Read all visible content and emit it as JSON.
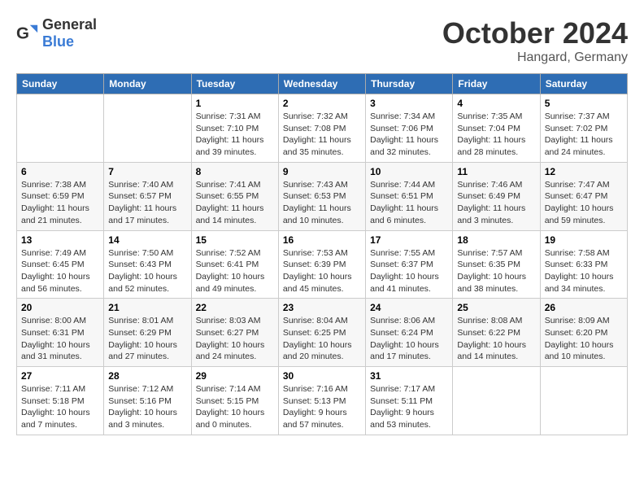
{
  "header": {
    "logo_general": "General",
    "logo_blue": "Blue",
    "month_title": "October 2024",
    "location": "Hangard, Germany"
  },
  "weekdays": [
    "Sunday",
    "Monday",
    "Tuesday",
    "Wednesday",
    "Thursday",
    "Friday",
    "Saturday"
  ],
  "weeks": [
    [
      {
        "day": "",
        "sunrise": "",
        "sunset": "",
        "daylight": ""
      },
      {
        "day": "",
        "sunrise": "",
        "sunset": "",
        "daylight": ""
      },
      {
        "day": "1",
        "sunrise": "Sunrise: 7:31 AM",
        "sunset": "Sunset: 7:10 PM",
        "daylight": "Daylight: 11 hours and 39 minutes."
      },
      {
        "day": "2",
        "sunrise": "Sunrise: 7:32 AM",
        "sunset": "Sunset: 7:08 PM",
        "daylight": "Daylight: 11 hours and 35 minutes."
      },
      {
        "day": "3",
        "sunrise": "Sunrise: 7:34 AM",
        "sunset": "Sunset: 7:06 PM",
        "daylight": "Daylight: 11 hours and 32 minutes."
      },
      {
        "day": "4",
        "sunrise": "Sunrise: 7:35 AM",
        "sunset": "Sunset: 7:04 PM",
        "daylight": "Daylight: 11 hours and 28 minutes."
      },
      {
        "day": "5",
        "sunrise": "Sunrise: 7:37 AM",
        "sunset": "Sunset: 7:02 PM",
        "daylight": "Daylight: 11 hours and 24 minutes."
      }
    ],
    [
      {
        "day": "6",
        "sunrise": "Sunrise: 7:38 AM",
        "sunset": "Sunset: 6:59 PM",
        "daylight": "Daylight: 11 hours and 21 minutes."
      },
      {
        "day": "7",
        "sunrise": "Sunrise: 7:40 AM",
        "sunset": "Sunset: 6:57 PM",
        "daylight": "Daylight: 11 hours and 17 minutes."
      },
      {
        "day": "8",
        "sunrise": "Sunrise: 7:41 AM",
        "sunset": "Sunset: 6:55 PM",
        "daylight": "Daylight: 11 hours and 14 minutes."
      },
      {
        "day": "9",
        "sunrise": "Sunrise: 7:43 AM",
        "sunset": "Sunset: 6:53 PM",
        "daylight": "Daylight: 11 hours and 10 minutes."
      },
      {
        "day": "10",
        "sunrise": "Sunrise: 7:44 AM",
        "sunset": "Sunset: 6:51 PM",
        "daylight": "Daylight: 11 hours and 6 minutes."
      },
      {
        "day": "11",
        "sunrise": "Sunrise: 7:46 AM",
        "sunset": "Sunset: 6:49 PM",
        "daylight": "Daylight: 11 hours and 3 minutes."
      },
      {
        "day": "12",
        "sunrise": "Sunrise: 7:47 AM",
        "sunset": "Sunset: 6:47 PM",
        "daylight": "Daylight: 10 hours and 59 minutes."
      }
    ],
    [
      {
        "day": "13",
        "sunrise": "Sunrise: 7:49 AM",
        "sunset": "Sunset: 6:45 PM",
        "daylight": "Daylight: 10 hours and 56 minutes."
      },
      {
        "day": "14",
        "sunrise": "Sunrise: 7:50 AM",
        "sunset": "Sunset: 6:43 PM",
        "daylight": "Daylight: 10 hours and 52 minutes."
      },
      {
        "day": "15",
        "sunrise": "Sunrise: 7:52 AM",
        "sunset": "Sunset: 6:41 PM",
        "daylight": "Daylight: 10 hours and 49 minutes."
      },
      {
        "day": "16",
        "sunrise": "Sunrise: 7:53 AM",
        "sunset": "Sunset: 6:39 PM",
        "daylight": "Daylight: 10 hours and 45 minutes."
      },
      {
        "day": "17",
        "sunrise": "Sunrise: 7:55 AM",
        "sunset": "Sunset: 6:37 PM",
        "daylight": "Daylight: 10 hours and 41 minutes."
      },
      {
        "day": "18",
        "sunrise": "Sunrise: 7:57 AM",
        "sunset": "Sunset: 6:35 PM",
        "daylight": "Daylight: 10 hours and 38 minutes."
      },
      {
        "day": "19",
        "sunrise": "Sunrise: 7:58 AM",
        "sunset": "Sunset: 6:33 PM",
        "daylight": "Daylight: 10 hours and 34 minutes."
      }
    ],
    [
      {
        "day": "20",
        "sunrise": "Sunrise: 8:00 AM",
        "sunset": "Sunset: 6:31 PM",
        "daylight": "Daylight: 10 hours and 31 minutes."
      },
      {
        "day": "21",
        "sunrise": "Sunrise: 8:01 AM",
        "sunset": "Sunset: 6:29 PM",
        "daylight": "Daylight: 10 hours and 27 minutes."
      },
      {
        "day": "22",
        "sunrise": "Sunrise: 8:03 AM",
        "sunset": "Sunset: 6:27 PM",
        "daylight": "Daylight: 10 hours and 24 minutes."
      },
      {
        "day": "23",
        "sunrise": "Sunrise: 8:04 AM",
        "sunset": "Sunset: 6:25 PM",
        "daylight": "Daylight: 10 hours and 20 minutes."
      },
      {
        "day": "24",
        "sunrise": "Sunrise: 8:06 AM",
        "sunset": "Sunset: 6:24 PM",
        "daylight": "Daylight: 10 hours and 17 minutes."
      },
      {
        "day": "25",
        "sunrise": "Sunrise: 8:08 AM",
        "sunset": "Sunset: 6:22 PM",
        "daylight": "Daylight: 10 hours and 14 minutes."
      },
      {
        "day": "26",
        "sunrise": "Sunrise: 8:09 AM",
        "sunset": "Sunset: 6:20 PM",
        "daylight": "Daylight: 10 hours and 10 minutes."
      }
    ],
    [
      {
        "day": "27",
        "sunrise": "Sunrise: 7:11 AM",
        "sunset": "Sunset: 5:18 PM",
        "daylight": "Daylight: 10 hours and 7 minutes."
      },
      {
        "day": "28",
        "sunrise": "Sunrise: 7:12 AM",
        "sunset": "Sunset: 5:16 PM",
        "daylight": "Daylight: 10 hours and 3 minutes."
      },
      {
        "day": "29",
        "sunrise": "Sunrise: 7:14 AM",
        "sunset": "Sunset: 5:15 PM",
        "daylight": "Daylight: 10 hours and 0 minutes."
      },
      {
        "day": "30",
        "sunrise": "Sunrise: 7:16 AM",
        "sunset": "Sunset: 5:13 PM",
        "daylight": "Daylight: 9 hours and 57 minutes."
      },
      {
        "day": "31",
        "sunrise": "Sunrise: 7:17 AM",
        "sunset": "Sunset: 5:11 PM",
        "daylight": "Daylight: 9 hours and 53 minutes."
      },
      {
        "day": "",
        "sunrise": "",
        "sunset": "",
        "daylight": ""
      },
      {
        "day": "",
        "sunrise": "",
        "sunset": "",
        "daylight": ""
      }
    ]
  ]
}
